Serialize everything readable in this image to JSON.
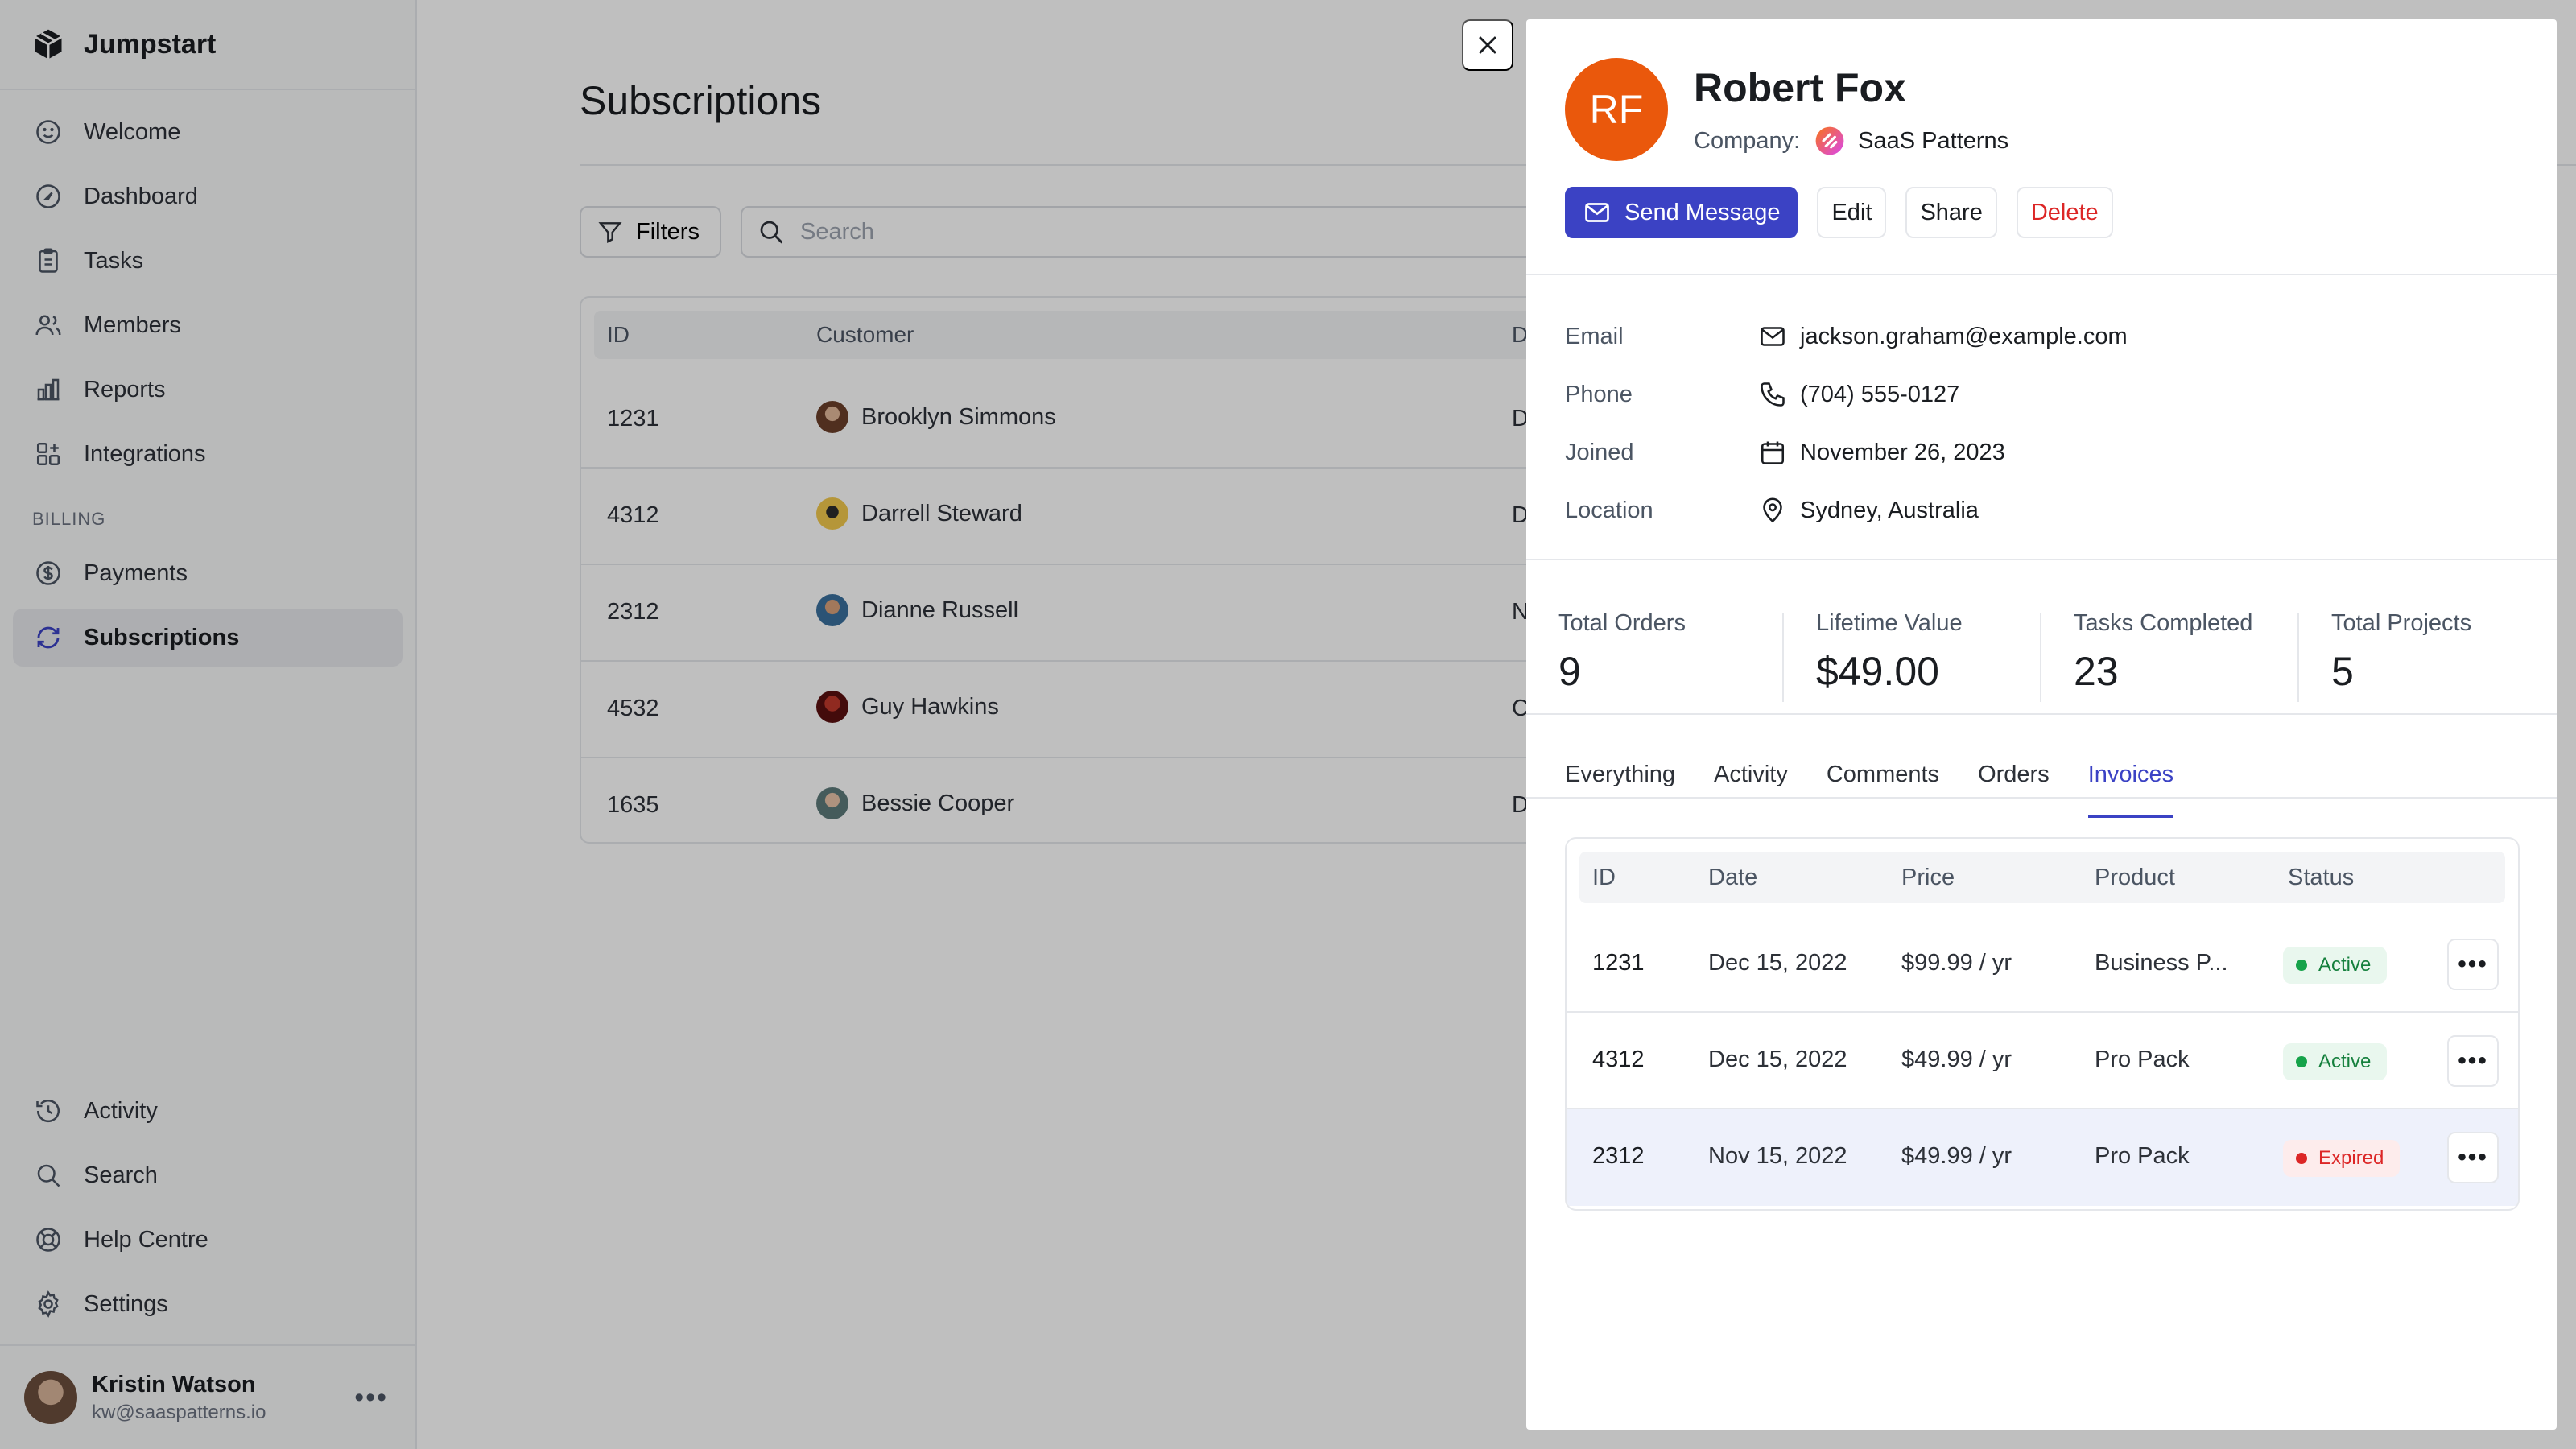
{
  "app": {
    "name": "Jumpstart"
  },
  "sidebar": {
    "items": [
      {
        "label": "Welcome",
        "icon": "smile-icon"
      },
      {
        "label": "Dashboard",
        "icon": "gauge-icon"
      },
      {
        "label": "Tasks",
        "icon": "clipboard-icon"
      },
      {
        "label": "Members",
        "icon": "users-icon"
      },
      {
        "label": "Reports",
        "icon": "bar-chart-icon"
      },
      {
        "label": "Integrations",
        "icon": "grid-plus-icon"
      }
    ],
    "billing_label": "BILLING",
    "billing_items": [
      {
        "label": "Payments",
        "icon": "dollar-circle-icon"
      },
      {
        "label": "Subscriptions",
        "icon": "refresh-icon",
        "active": true
      }
    ],
    "bottom_items": [
      {
        "label": "Activity",
        "icon": "history-icon"
      },
      {
        "label": "Search",
        "icon": "search-icon"
      },
      {
        "label": "Help Centre",
        "icon": "lifebuoy-icon"
      },
      {
        "label": "Settings",
        "icon": "gear-icon"
      }
    ],
    "user": {
      "name": "Kristin Watson",
      "email": "kw@saaspatterns.io",
      "menu": "•••"
    }
  },
  "main": {
    "title": "Subscriptions",
    "filters_label": "Filters",
    "search_placeholder": "Search",
    "table": {
      "columns": [
        "ID",
        "Customer",
        "D"
      ],
      "rows": [
        {
          "id": "1231",
          "customer": "Brooklyn Simmons",
          "trunc": "D"
        },
        {
          "id": "4312",
          "customer": "Darrell Steward",
          "trunc": "D"
        },
        {
          "id": "2312",
          "customer": "Dianne Russell",
          "trunc": "N"
        },
        {
          "id": "4532",
          "customer": "Guy Hawkins",
          "trunc": "C"
        },
        {
          "id": "1635",
          "customer": "Bessie Cooper",
          "trunc": "D"
        }
      ]
    }
  },
  "drawer": {
    "initials": "RF",
    "name": "Robert Fox",
    "company_label": "Company:",
    "company_name": "SaaS Patterns",
    "actions": {
      "send": "Send Message",
      "edit": "Edit",
      "share": "Share",
      "delete": "Delete"
    },
    "details": [
      {
        "label": "Email",
        "value": "jackson.graham@example.com",
        "icon": "mail-icon"
      },
      {
        "label": "Phone",
        "value": "(704) 555-0127",
        "icon": "phone-icon"
      },
      {
        "label": "Joined",
        "value": "November 26, 2023",
        "icon": "calendar-icon"
      },
      {
        "label": "Location",
        "value": "Sydney, Australia",
        "icon": "map-pin-icon"
      }
    ],
    "stats": [
      {
        "label": "Total Orders",
        "value": "9"
      },
      {
        "label": "Lifetime Value",
        "value": "$49.00"
      },
      {
        "label": "Tasks Completed",
        "value": "23"
      },
      {
        "label": "Total Projects",
        "value": "5"
      }
    ],
    "tabs": [
      "Everything",
      "Activity",
      "Comments",
      "Orders",
      "Invoices"
    ],
    "active_tab": "Invoices",
    "invoices": {
      "columns": [
        "ID",
        "Date",
        "Price",
        "Product",
        "Status"
      ],
      "rows": [
        {
          "id": "1231",
          "date": "Dec 15, 2022",
          "price": "$99.99 / yr",
          "product": "Business P...",
          "status": "Active"
        },
        {
          "id": "4312",
          "date": "Dec 15, 2022",
          "price": "$49.99 / yr",
          "product": "Pro Pack",
          "status": "Active"
        },
        {
          "id": "2312",
          "date": "Nov 15, 2022",
          "price": "$49.99 / yr",
          "product": "Pro Pack",
          "status": "Expired"
        }
      ],
      "more": "•••"
    }
  },
  "colors": {
    "accent": "#3b42c4",
    "avatar": "#ea580c",
    "danger": "#dc2626",
    "success": "#16a34a"
  }
}
